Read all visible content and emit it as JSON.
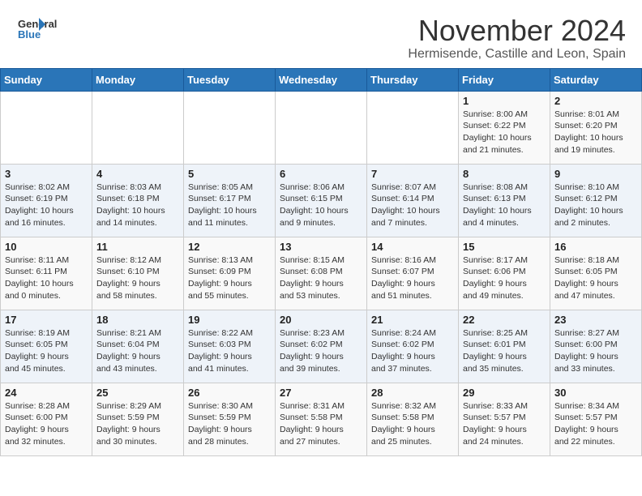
{
  "header": {
    "logo_line1": "General",
    "logo_line2": "Blue",
    "month": "November 2024",
    "location": "Hermisende, Castille and Leon, Spain"
  },
  "weekdays": [
    "Sunday",
    "Monday",
    "Tuesday",
    "Wednesday",
    "Thursday",
    "Friday",
    "Saturday"
  ],
  "weeks": [
    [
      {
        "day": "",
        "info": ""
      },
      {
        "day": "",
        "info": ""
      },
      {
        "day": "",
        "info": ""
      },
      {
        "day": "",
        "info": ""
      },
      {
        "day": "",
        "info": ""
      },
      {
        "day": "1",
        "info": "Sunrise: 8:00 AM\nSunset: 6:22 PM\nDaylight: 10 hours\nand 21 minutes."
      },
      {
        "day": "2",
        "info": "Sunrise: 8:01 AM\nSunset: 6:20 PM\nDaylight: 10 hours\nand 19 minutes."
      }
    ],
    [
      {
        "day": "3",
        "info": "Sunrise: 8:02 AM\nSunset: 6:19 PM\nDaylight: 10 hours\nand 16 minutes."
      },
      {
        "day": "4",
        "info": "Sunrise: 8:03 AM\nSunset: 6:18 PM\nDaylight: 10 hours\nand 14 minutes."
      },
      {
        "day": "5",
        "info": "Sunrise: 8:05 AM\nSunset: 6:17 PM\nDaylight: 10 hours\nand 11 minutes."
      },
      {
        "day": "6",
        "info": "Sunrise: 8:06 AM\nSunset: 6:15 PM\nDaylight: 10 hours\nand 9 minutes."
      },
      {
        "day": "7",
        "info": "Sunrise: 8:07 AM\nSunset: 6:14 PM\nDaylight: 10 hours\nand 7 minutes."
      },
      {
        "day": "8",
        "info": "Sunrise: 8:08 AM\nSunset: 6:13 PM\nDaylight: 10 hours\nand 4 minutes."
      },
      {
        "day": "9",
        "info": "Sunrise: 8:10 AM\nSunset: 6:12 PM\nDaylight: 10 hours\nand 2 minutes."
      }
    ],
    [
      {
        "day": "10",
        "info": "Sunrise: 8:11 AM\nSunset: 6:11 PM\nDaylight: 10 hours\nand 0 minutes."
      },
      {
        "day": "11",
        "info": "Sunrise: 8:12 AM\nSunset: 6:10 PM\nDaylight: 9 hours\nand 58 minutes."
      },
      {
        "day": "12",
        "info": "Sunrise: 8:13 AM\nSunset: 6:09 PM\nDaylight: 9 hours\nand 55 minutes."
      },
      {
        "day": "13",
        "info": "Sunrise: 8:15 AM\nSunset: 6:08 PM\nDaylight: 9 hours\nand 53 minutes."
      },
      {
        "day": "14",
        "info": "Sunrise: 8:16 AM\nSunset: 6:07 PM\nDaylight: 9 hours\nand 51 minutes."
      },
      {
        "day": "15",
        "info": "Sunrise: 8:17 AM\nSunset: 6:06 PM\nDaylight: 9 hours\nand 49 minutes."
      },
      {
        "day": "16",
        "info": "Sunrise: 8:18 AM\nSunset: 6:05 PM\nDaylight: 9 hours\nand 47 minutes."
      }
    ],
    [
      {
        "day": "17",
        "info": "Sunrise: 8:19 AM\nSunset: 6:05 PM\nDaylight: 9 hours\nand 45 minutes."
      },
      {
        "day": "18",
        "info": "Sunrise: 8:21 AM\nSunset: 6:04 PM\nDaylight: 9 hours\nand 43 minutes."
      },
      {
        "day": "19",
        "info": "Sunrise: 8:22 AM\nSunset: 6:03 PM\nDaylight: 9 hours\nand 41 minutes."
      },
      {
        "day": "20",
        "info": "Sunrise: 8:23 AM\nSunset: 6:02 PM\nDaylight: 9 hours\nand 39 minutes."
      },
      {
        "day": "21",
        "info": "Sunrise: 8:24 AM\nSunset: 6:02 PM\nDaylight: 9 hours\nand 37 minutes."
      },
      {
        "day": "22",
        "info": "Sunrise: 8:25 AM\nSunset: 6:01 PM\nDaylight: 9 hours\nand 35 minutes."
      },
      {
        "day": "23",
        "info": "Sunrise: 8:27 AM\nSunset: 6:00 PM\nDaylight: 9 hours\nand 33 minutes."
      }
    ],
    [
      {
        "day": "24",
        "info": "Sunrise: 8:28 AM\nSunset: 6:00 PM\nDaylight: 9 hours\nand 32 minutes."
      },
      {
        "day": "25",
        "info": "Sunrise: 8:29 AM\nSunset: 5:59 PM\nDaylight: 9 hours\nand 30 minutes."
      },
      {
        "day": "26",
        "info": "Sunrise: 8:30 AM\nSunset: 5:59 PM\nDaylight: 9 hours\nand 28 minutes."
      },
      {
        "day": "27",
        "info": "Sunrise: 8:31 AM\nSunset: 5:58 PM\nDaylight: 9 hours\nand 27 minutes."
      },
      {
        "day": "28",
        "info": "Sunrise: 8:32 AM\nSunset: 5:58 PM\nDaylight: 9 hours\nand 25 minutes."
      },
      {
        "day": "29",
        "info": "Sunrise: 8:33 AM\nSunset: 5:57 PM\nDaylight: 9 hours\nand 24 minutes."
      },
      {
        "day": "30",
        "info": "Sunrise: 8:34 AM\nSunset: 5:57 PM\nDaylight: 9 hours\nand 22 minutes."
      }
    ]
  ]
}
